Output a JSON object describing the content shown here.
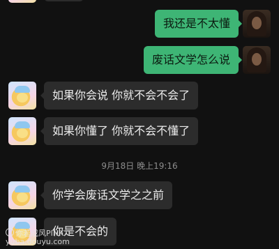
{
  "messages": [
    {
      "sender": "me",
      "text": "我还是不太懂"
    },
    {
      "sender": "me",
      "text": "废话文学怎么说"
    },
    {
      "sender": "peer",
      "text": "如果你会说 你就不会不会了"
    },
    {
      "sender": "peer",
      "text": "如果你懂了 你就不会不懂了"
    },
    {
      "sender": "peer",
      "text": "你学会废话文学之之前"
    },
    {
      "sender": "peer",
      "text": "你是不会的"
    }
  ],
  "timestamp": "9月18日 晚上19:16",
  "watermark": {
    "line1": "你若成风PINK",
    "line2": "yuba.douyu.com"
  },
  "colors": {
    "background": "#111111",
    "sent_bubble": "#3eb575",
    "received_bubble": "#2c2c2c",
    "timestamp_text": "#8d8d8d"
  }
}
